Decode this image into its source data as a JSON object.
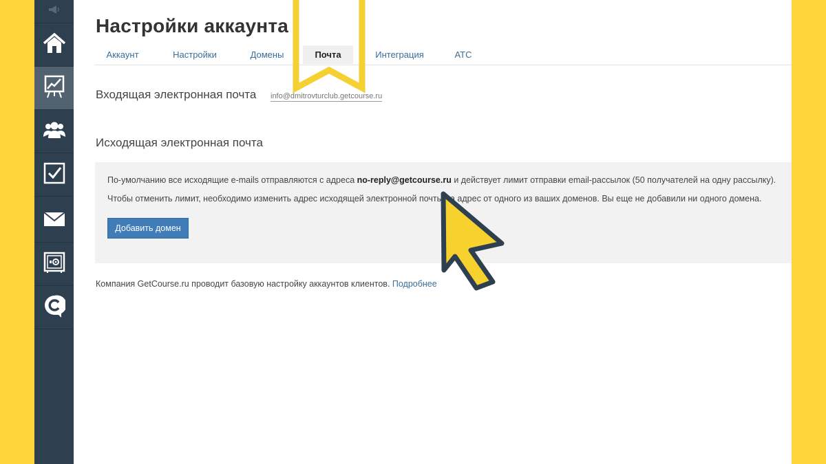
{
  "page": {
    "title": "Настройки аккаунта"
  },
  "tabs": [
    {
      "label": "Аккаунт",
      "active": false
    },
    {
      "label": "Настройки",
      "active": false
    },
    {
      "label": "Домены",
      "active": false
    },
    {
      "label": "Почта",
      "active": true
    },
    {
      "label": "Интеграция",
      "active": false
    },
    {
      "label": "АТС",
      "active": false
    }
  ],
  "sidebar": {
    "top_icon": "megaphone-icon",
    "items": [
      {
        "icon": "home-icon",
        "active": false
      },
      {
        "icon": "chart-icon",
        "active": true
      },
      {
        "icon": "users-icon",
        "active": false
      },
      {
        "icon": "checkbox-icon",
        "active": false
      },
      {
        "icon": "mail-icon",
        "active": false
      },
      {
        "icon": "safe-icon",
        "active": false
      },
      {
        "icon": "getcourse-logo-icon",
        "active": false
      }
    ]
  },
  "incoming": {
    "title": "Входящая электронная почта",
    "address": "info@dmitrovturclub.getcourse.ru"
  },
  "outgoing": {
    "title": "Исходящая электронная почта",
    "line1_before": "По-умолчанию все исходящие e-mails отправляются с адреса ",
    "line1_address": "no-reply@getcourse.ru",
    "line1_after": " и действует лимит отправки email-рассылок (50 получателей на одну рассылку).",
    "line2": "Чтобы отменить лимит, необходимо изменить адрес исходящей электронной почты на адрес от одного из ваших доменов. Вы еще не добавили ни одного домена.",
    "button_label": "Добавить домен"
  },
  "footer": {
    "text": "Компания GetCourse.ru проводит базовую настройку аккаунтов клиентов. ",
    "link": "Подробнее"
  },
  "colors": {
    "frame": "#FFD43A",
    "sidebar": "#2E3F4F",
    "sidebar_active": "#536270",
    "accent_button": "#3F7CB8",
    "link": "#3A6D98",
    "highlight": "#F5D033",
    "cursor_fill": "#F7D12E",
    "cursor_outline": "#2E3F4F"
  }
}
